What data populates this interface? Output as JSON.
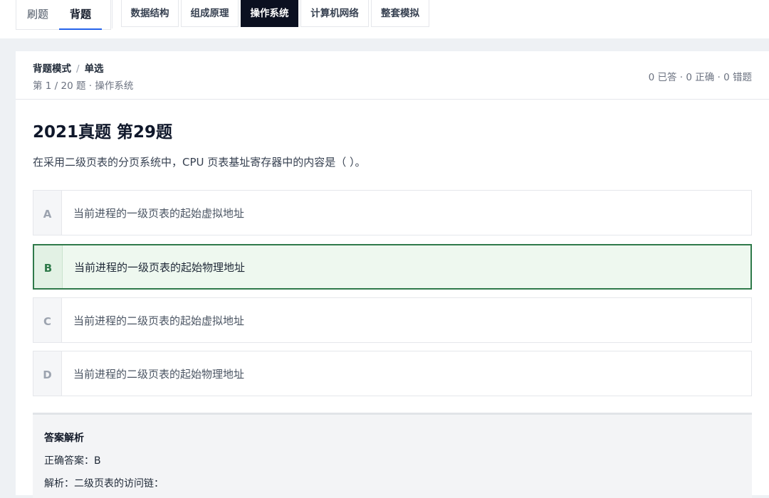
{
  "mode_tabs": [
    "刷题",
    "背题"
  ],
  "subject_tabs": [
    "数据结构",
    "组成原理",
    "操作系统",
    "计算机网络",
    "整套模拟"
  ],
  "header": {
    "mode": "背题模式",
    "type": "单选",
    "progress": "第 1 / 20 题 · 操作系统",
    "stats": "0 已答 · 0 正确 · 0 错题"
  },
  "question": {
    "title": "2021真题 第29题",
    "text": "在采用二级页表的分页系统中，CPU 页表基址寄存器中的内容是（ ）。",
    "options": [
      {
        "letter": "A",
        "text": "当前进程的一级页表的起始虚拟地址"
      },
      {
        "letter": "B",
        "text": "当前进程的一级页表的起始物理地址"
      },
      {
        "letter": "C",
        "text": "当前进程的二级页表的起始虚拟地址"
      },
      {
        "letter": "D",
        "text": "当前进程的二级页表的起始物理地址"
      }
    ]
  },
  "answer": {
    "title": "答案解析",
    "correct": "正确答案：B",
    "explanation": "解析：二级页表的访问链："
  },
  "colors": {
    "active_subject_bg": "#0b1020",
    "active_mode_underline": "#2563eb",
    "correct_border": "#2f7a4a",
    "correct_bg": "#eef8ef"
  }
}
